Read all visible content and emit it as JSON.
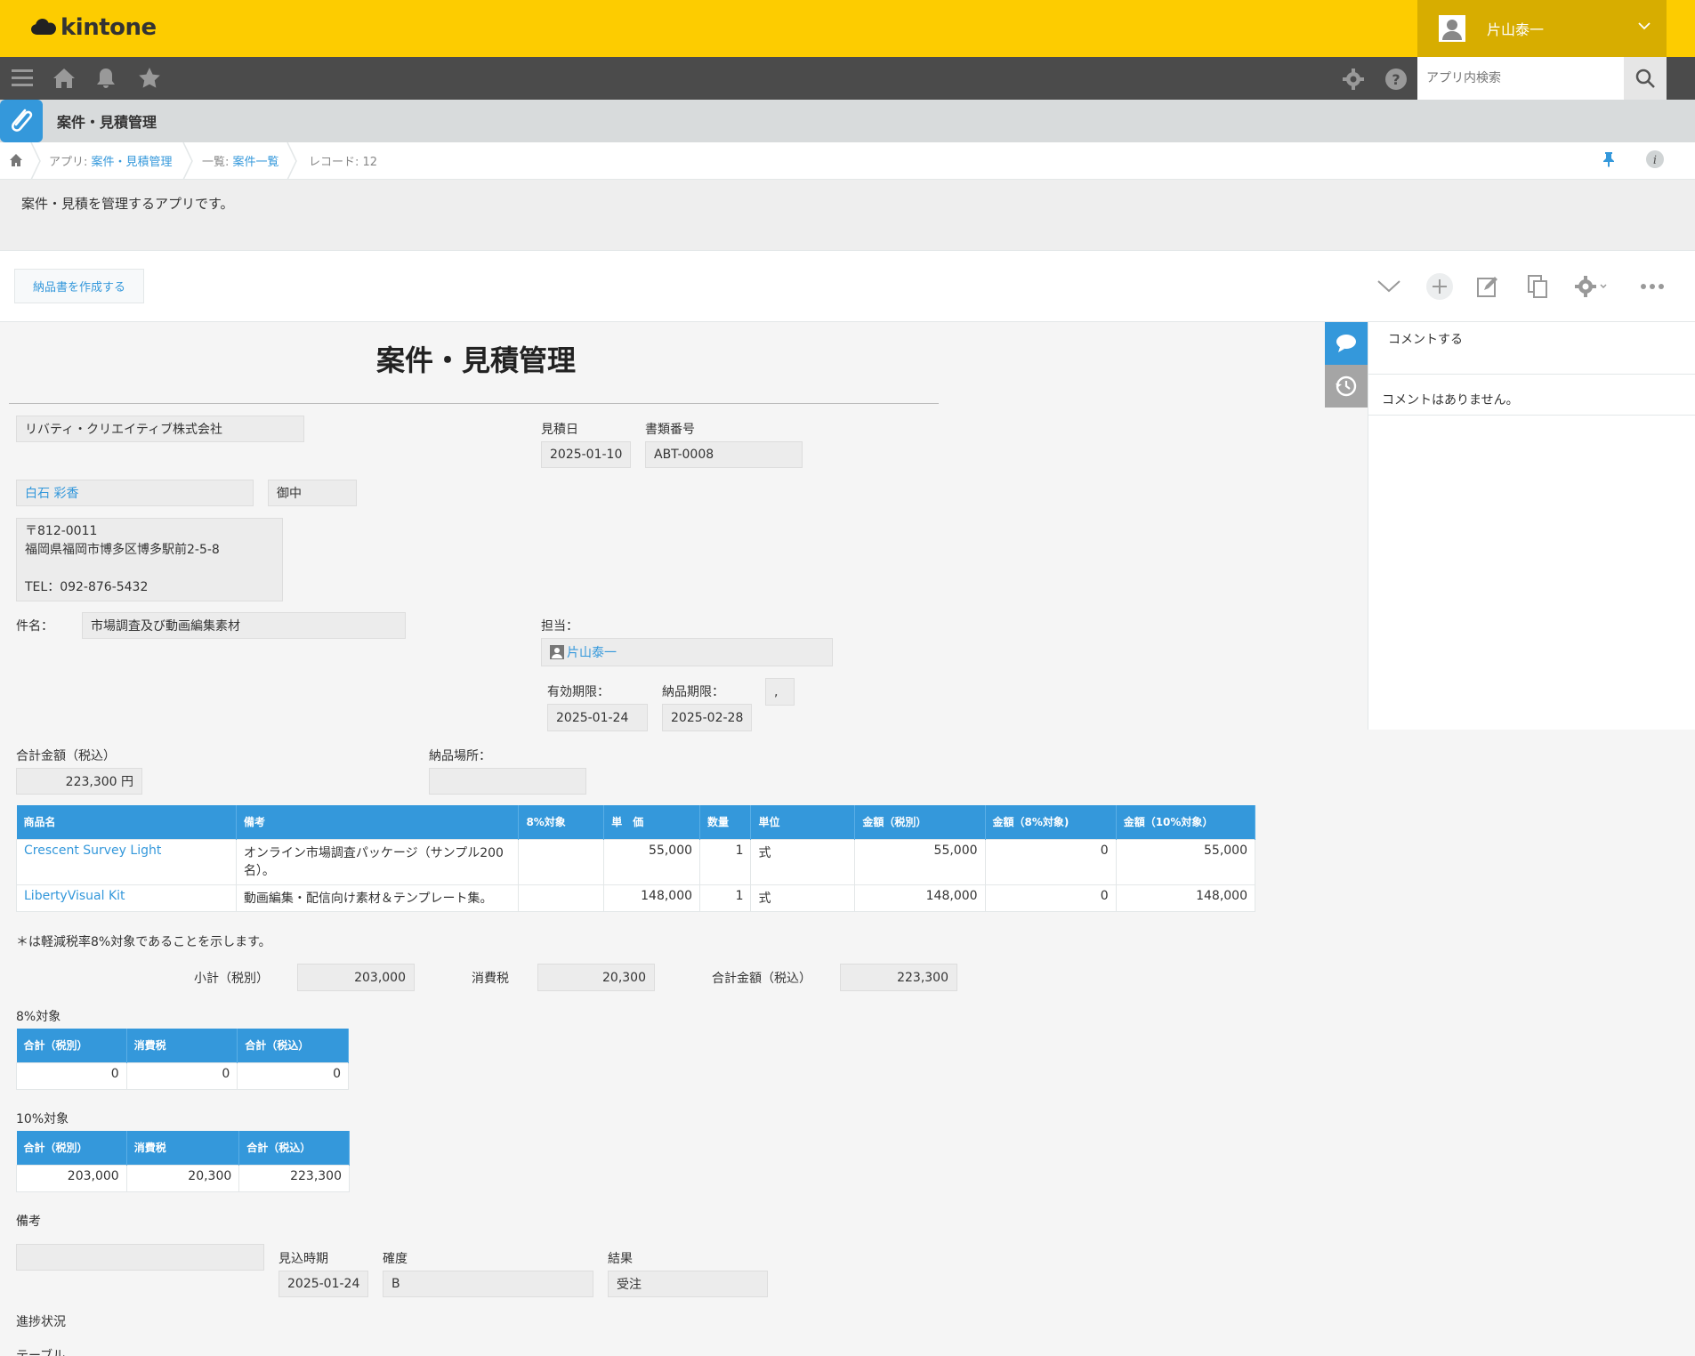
{
  "header": {
    "logo": "kintone",
    "user_name": "片山泰一"
  },
  "search": {
    "placeholder": "アプリ内検索"
  },
  "app": {
    "title": "案件・見積管理",
    "description": "案件・見積を管理するアプリです。"
  },
  "breadcrumb": {
    "app_prefix": "アプリ: ",
    "app_name": "案件・見積管理",
    "view_prefix": "一覧: ",
    "view_name": "案件一覧",
    "record": "レコード: 12"
  },
  "toolbar": {
    "create_delivery_label": "納品書を作成する"
  },
  "record": {
    "form_title": "案件・見積管理",
    "company": "リバティ・クリエイティブ株式会社",
    "contact": "白石 彩香",
    "honorific": "御中",
    "address_lines": [
      "〒812-0011",
      "福岡県福岡市博多区博多駅前2-5-8",
      "",
      "TEL：092-876-5432"
    ],
    "estimate_date_label": "見積日",
    "estimate_date": "2025-01-10",
    "doc_no_label": "書類番号",
    "doc_no": "ABT-0008",
    "subject_label": "件名：",
    "subject": "市場調査及び動画編集素材",
    "owner_label": "担当：",
    "owner": "片山泰一",
    "valid_label": "有効期限：",
    "valid_date": "2025-01-24",
    "delivery_label": "納品期限：",
    "delivery_date": "2025-02-28",
    "comma_field": ",",
    "total_label": "合計金額（税込）",
    "total_value": "223,300 円",
    "place_label": "納品場所：",
    "place_value": "",
    "items_headers": [
      "商品名",
      "備考",
      "8%対象",
      "単　価",
      "数量",
      "単位",
      "金額（税別）",
      "金額（8%対象)",
      "金額（10%対象）"
    ],
    "items": [
      {
        "name": "Crescent Survey Light",
        "note": "オンライン市場調査パッケージ（サンプル200名）。",
        "reduced": "",
        "price": "55,000",
        "qty": "1",
        "unit": "式",
        "amount": "55,000",
        "amount8": "0",
        "amount10": "55,000"
      },
      {
        "name": "LibertyVisual Kit",
        "note": "動画編集・配信向け素材＆テンプレート集。",
        "reduced": "",
        "price": "148,000",
        "qty": "1",
        "unit": "式",
        "amount": "148,000",
        "amount8": "0",
        "amount10": "148,000"
      }
    ],
    "reduced_note": "＊は軽減税率8%対象であることを示します。",
    "subtotal_label": "小計（税別）",
    "subtotal": "203,000",
    "tax_label": "消費税",
    "tax": "20,300",
    "grand_label": "合計金額（税込）",
    "grand": "223,300",
    "t8_label": "8%対象",
    "t10_label": "10%対象",
    "tax_headers": [
      "合計（税別）",
      "消費税",
      "合計（税込）"
    ],
    "t8_values": [
      "0",
      "0",
      "0"
    ],
    "t10_values": [
      "203,000",
      "20,300",
      "223,300"
    ],
    "remarks_label": "備考",
    "remarks": "",
    "expect_label": "見込時期",
    "expect": "2025-01-24",
    "certainty_label": "確度",
    "certainty": "B",
    "result_label": "結果",
    "result": "受注",
    "progress_label": "進捗状況",
    "table_label": "テーブル"
  },
  "side": {
    "comment_placeholder": "コメントする",
    "no_comments": "コメントはありません。"
  },
  "colors": {
    "header": "#fdcc00",
    "accent": "#3498db",
    "navbar": "#4b4b4b"
  }
}
